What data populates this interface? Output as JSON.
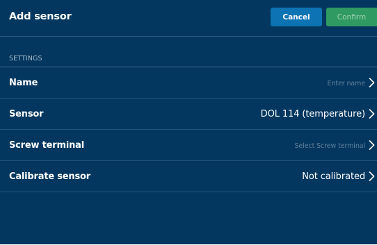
{
  "header": {
    "title": "Add sensor",
    "cancel_label": "Cancel",
    "confirm_label": "Confirm"
  },
  "settings": {
    "section_label": "SETTINGS",
    "rows": [
      {
        "label": "Name",
        "value": "Enter name",
        "is_placeholder": true
      },
      {
        "label": "Sensor",
        "value": "DOL 114 (temperature)",
        "is_placeholder": false
      },
      {
        "label": "Screw terminal",
        "value": "Select Screw terminal",
        "is_placeholder": true
      },
      {
        "label": "Calibrate sensor",
        "value": "Not calibrated",
        "is_placeholder": false
      }
    ]
  },
  "icons": {
    "row_chevron": "chevron-right-icon"
  },
  "colors": {
    "background": "#04375f",
    "cancel_button": "#0d73b3",
    "confirm_button": "#2f9a61",
    "confirm_text_disabled": "#9fd2b6",
    "placeholder_text": "#607f99",
    "section_label": "#a8bccd"
  }
}
